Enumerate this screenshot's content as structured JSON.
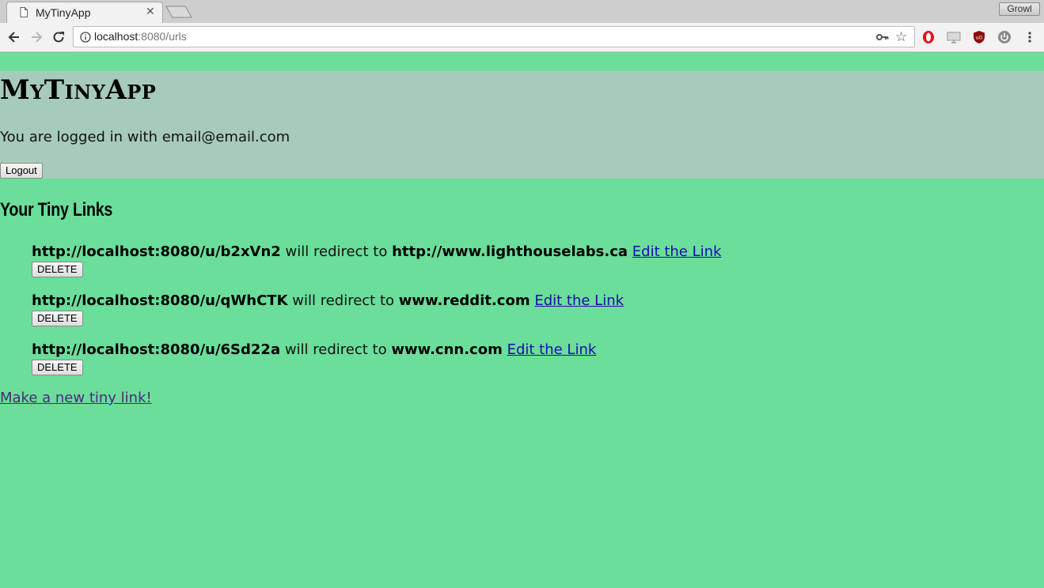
{
  "browser": {
    "tab_title": "MyTinyApp",
    "growl_label": "Growl",
    "url_host": "localhost",
    "url_rest": ":8080/urls"
  },
  "app": {
    "brand": "MyTinyApp",
    "logged_in_text": "You are logged in with email@email.com",
    "logout_label": "Logout",
    "section_title": "Your Tiny Links",
    "links": [
      {
        "short": "http://localhost:8080/u/b2xVn2",
        "middle": " will redirect to ",
        "long": "http://www.lighthouselabs.ca",
        "edit": "Edit the Link",
        "delete": "DELETE"
      },
      {
        "short": "http://localhost:8080/u/qWhCTK",
        "middle": " will redirect to ",
        "long": "www.reddit.com",
        "edit": "Edit the Link",
        "delete": "DELETE"
      },
      {
        "short": "http://localhost:8080/u/6Sd22a",
        "middle": " will redirect to ",
        "long": "www.cnn.com",
        "edit": "Edit the Link",
        "delete": "DELETE"
      }
    ],
    "new_link_label": "Make a new tiny link!"
  },
  "colors": {
    "page_bg": "#6ade9a",
    "header_bg": "#a7cbbb",
    "link": "#1a0dab",
    "visited_link": "#4b2a7a"
  }
}
